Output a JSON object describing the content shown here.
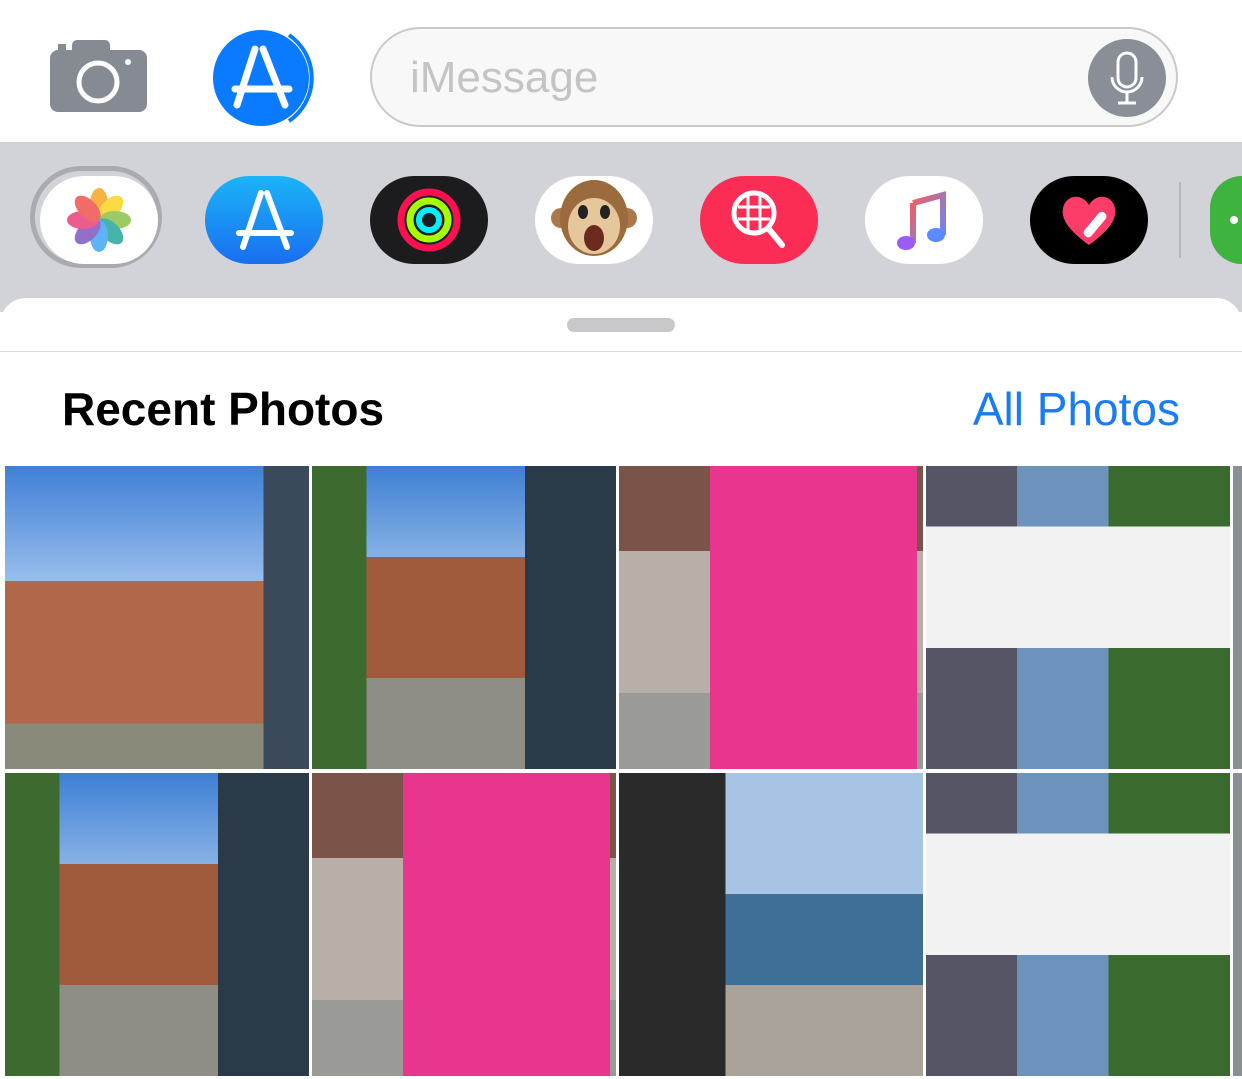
{
  "input_bar": {
    "placeholder": "iMessage",
    "camera_icon": "camera-icon",
    "apps_icon": "app-store-icon",
    "mic_icon": "microphone-icon"
  },
  "app_drawer": {
    "items": [
      {
        "name": "Photos",
        "icon": "photos-icon",
        "selected": true
      },
      {
        "name": "App Store",
        "icon": "app-store-icon"
      },
      {
        "name": "Activity",
        "icon": "activity-rings-icon"
      },
      {
        "name": "Animoji",
        "icon": "monkey-animoji-icon"
      },
      {
        "name": "Images Search",
        "icon": "globe-search-icon"
      },
      {
        "name": "Music",
        "icon": "music-note-icon"
      },
      {
        "name": "Digital Touch",
        "icon": "heart-touch-icon"
      },
      {
        "name": "More",
        "icon": "more-icon"
      }
    ]
  },
  "photos": {
    "title": "Recent Photos",
    "all_link": "All Photos",
    "accent": "#1a7cf5",
    "items": [
      {
        "scene": "building-sky"
      },
      {
        "scene": "street-trees"
      },
      {
        "scene": "pink-kiosk"
      },
      {
        "scene": "bus-street"
      },
      {
        "scene": "street-trees"
      },
      {
        "scene": "pink-kiosk"
      },
      {
        "scene": "camera-man"
      },
      {
        "scene": "bus-street"
      }
    ]
  }
}
